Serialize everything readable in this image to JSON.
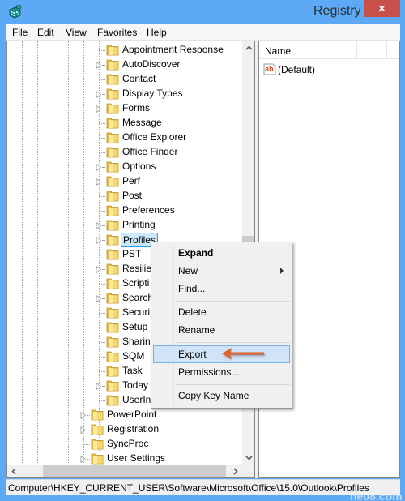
{
  "window": {
    "title": "Registry Editor",
    "title_visible": "Registry E",
    "close_glyph": "×",
    "app_icon": "registry-cube-icon"
  },
  "menubar": {
    "items": [
      {
        "label": "File"
      },
      {
        "label": "Edit"
      },
      {
        "label": "View"
      },
      {
        "label": "Favorites"
      },
      {
        "label": "Help"
      }
    ]
  },
  "tree": {
    "children_of_outlook": [
      {
        "label": "Appointment Response",
        "expandable": false
      },
      {
        "label": "AutoDiscover",
        "expandable": true
      },
      {
        "label": "Contact",
        "expandable": false
      },
      {
        "label": "Display Types",
        "expandable": true
      },
      {
        "label": "Forms",
        "expandable": true
      },
      {
        "label": "Message",
        "expandable": false
      },
      {
        "label": "Office Explorer",
        "expandable": false
      },
      {
        "label": "Office Finder",
        "expandable": false
      },
      {
        "label": "Options",
        "expandable": true
      },
      {
        "label": "Perf",
        "expandable": true
      },
      {
        "label": "Post",
        "expandable": false
      },
      {
        "label": "Preferences",
        "expandable": false
      },
      {
        "label": "Printing",
        "expandable": true
      },
      {
        "label": "Profiles",
        "expandable": true,
        "selected": true
      },
      {
        "label": "PST",
        "expandable": false
      },
      {
        "label": "Resilie",
        "expandable": true
      },
      {
        "label": "Scripti",
        "expandable": false
      },
      {
        "label": "Search",
        "expandable": true
      },
      {
        "label": "Securi",
        "expandable": false
      },
      {
        "label": "Setup",
        "expandable": false
      },
      {
        "label": "Sharin",
        "expandable": false
      },
      {
        "label": "SQM",
        "expandable": false
      },
      {
        "label": "Task",
        "expandable": false
      },
      {
        "label": "Today",
        "expandable": true
      },
      {
        "label": "UserIn",
        "expandable": false
      }
    ],
    "siblings_of_outlook": [
      {
        "label": "PowerPoint",
        "expandable": true
      },
      {
        "label": "Registration",
        "expandable": true
      },
      {
        "label": "SyncProc",
        "expandable": false
      },
      {
        "label": "User Settings",
        "expandable": true
      }
    ],
    "scroll_up_glyph": "⌃",
    "scroll_down_glyph": "⌄",
    "scroll_left_glyph": "<",
    "scroll_right_glyph": ">"
  },
  "values_pane": {
    "column_name": "Name",
    "rows": [
      {
        "icon": "string-value-ab-icon",
        "name": "(Default)"
      }
    ]
  },
  "context_menu": {
    "items": [
      {
        "label": "Expand",
        "bold": true
      },
      {
        "label": "New",
        "submenu": true
      },
      {
        "label": "Find..."
      },
      {
        "label": "Delete"
      },
      {
        "label": "Rename"
      },
      {
        "label": "Export",
        "highlighted": true
      },
      {
        "label": "Permissions..."
      },
      {
        "label": "Copy Key Name"
      }
    ]
  },
  "annotation": {
    "arrow_color": "#e0622a",
    "points_to": "Export"
  },
  "statusbar": {
    "path": "Computer\\HKEY_CURRENT_USER\\Software\\Microsoft\\Office\\15.0\\Outlook\\Profiles"
  },
  "watermark": {
    "text": "ne08.com"
  }
}
